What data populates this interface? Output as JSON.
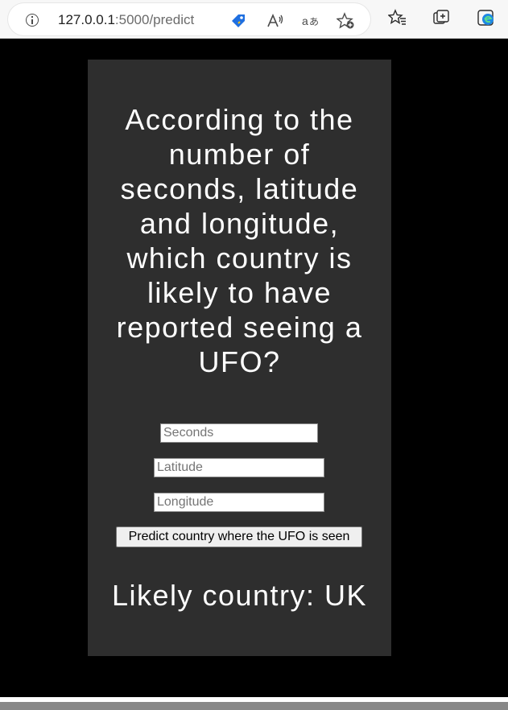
{
  "browser": {
    "url_host": "127.0.0.1",
    "url_path": ":5000/predict"
  },
  "page": {
    "heading": "According to the number of seconds, latitude and longitude, which country is likely to have reported seeing a UFO?",
    "seconds_placeholder": "Seconds",
    "latitude_placeholder": "Latitude",
    "longitude_placeholder": "Longitude",
    "predict_button_label": "Predict country where the UFO is seen",
    "result_text": "Likely country: UK"
  },
  "colors": {
    "page_background": "#000000",
    "card_background": "#2e2e2e",
    "text": "#ffffff"
  }
}
